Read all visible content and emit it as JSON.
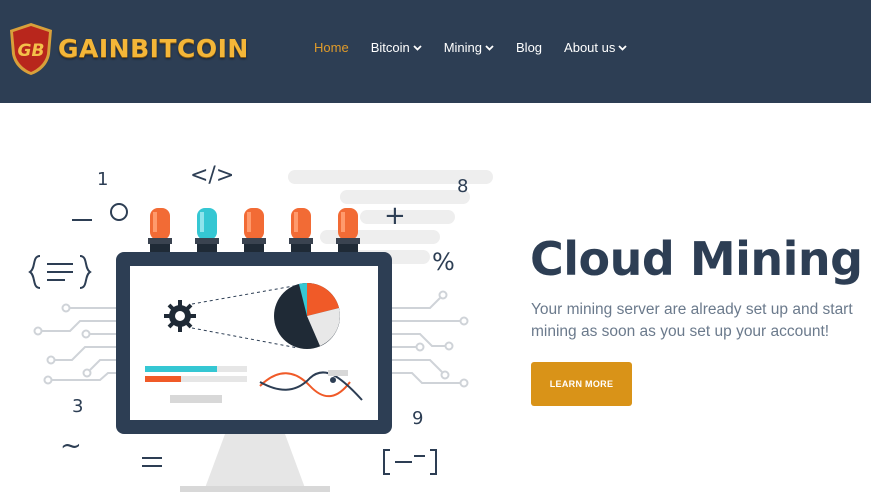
{
  "brand": {
    "name": "GAINBITCOIN",
    "monogram": "GB",
    "shield_color": "#b8261c",
    "text_color": "#f4b638"
  },
  "nav": {
    "items": [
      {
        "label": "Home",
        "active": true,
        "dropdown": false
      },
      {
        "label": "Bitcoin",
        "active": false,
        "dropdown": true
      },
      {
        "label": "Mining",
        "active": false,
        "dropdown": true
      },
      {
        "label": "Blog",
        "active": false,
        "dropdown": false
      },
      {
        "label": "About us",
        "active": false,
        "dropdown": true
      }
    ]
  },
  "hero": {
    "title": "Cloud Mining",
    "description": "Your mining server are already set up and start mining as soon as you set up your account!",
    "cta_label": "LEARN MORE"
  },
  "illustration": {
    "glyphs": {
      "one": "1",
      "eight": "8",
      "three": "3",
      "nine": "9",
      "code": "</>",
      "percent": "%",
      "plus": "+",
      "tilde": "~"
    }
  },
  "colors": {
    "header_bg": "#2d3e54",
    "accent": "#e09b2a",
    "button": "#d99318",
    "title": "#2d3e54",
    "text": "#6b7a8c"
  }
}
